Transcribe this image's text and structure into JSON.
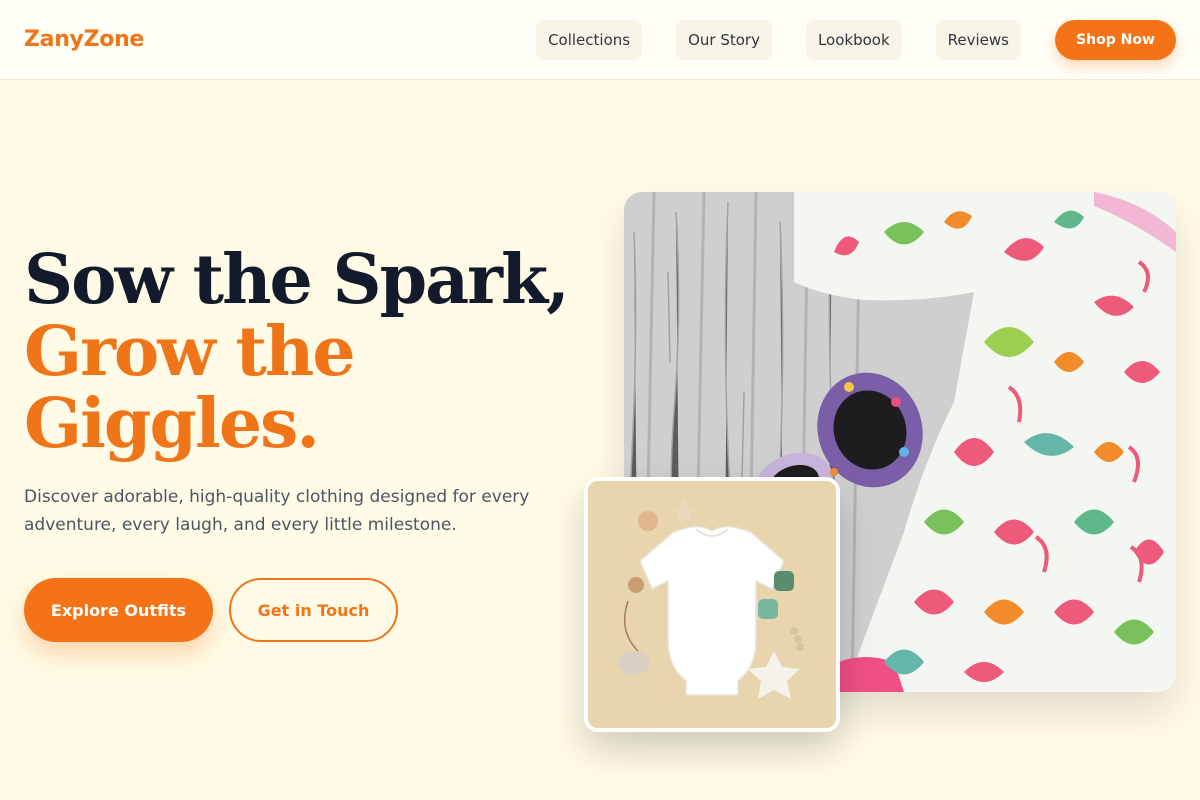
{
  "brand": {
    "name": "ZanyZone",
    "accent_color": "#f47316"
  },
  "nav": {
    "items": [
      {
        "label": "Collections"
      },
      {
        "label": "Our Story"
      },
      {
        "label": "Lookbook"
      },
      {
        "label": "Reviews"
      }
    ],
    "cta_label": "Shop Now"
  },
  "hero": {
    "title_line1": "Sow the Spark,",
    "title_line2": "Grow the",
    "title_line3": "Giggles.",
    "subtitle": "Discover adorable, high-quality clothing designed for every adventure, every laugh, and every little milestone.",
    "primary_cta": "Explore Outfits",
    "secondary_cta": "Get in Touch"
  },
  "images": {
    "main": {
      "icon": "flamingo-shirt-photo"
    },
    "small": {
      "icon": "baby-onesie-photo"
    }
  }
}
